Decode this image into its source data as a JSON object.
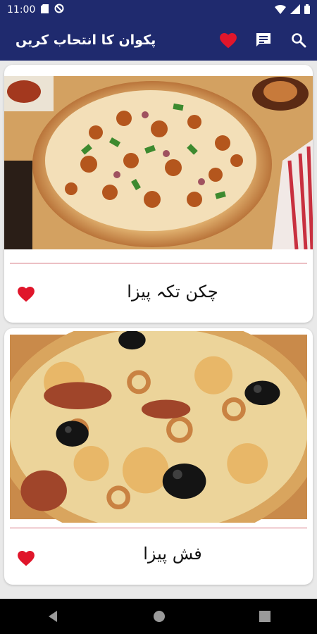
{
  "status_bar": {
    "time": "11:00"
  },
  "app_bar": {
    "title": "پکوان کا انتحاب کریں",
    "icons": [
      "heart-icon",
      "chat-icon",
      "search-icon"
    ]
  },
  "colors": {
    "primary": "#1f2a6e",
    "favorite": "#e0162b",
    "divider": "#d4707a"
  },
  "recipes": [
    {
      "title": "چکن تکہ پیزا",
      "image": "chicken-tikka-pizza-photo",
      "favorite": true
    },
    {
      "title": "فش پیزا",
      "image": "fish-pizza-photo",
      "favorite": true
    }
  ]
}
